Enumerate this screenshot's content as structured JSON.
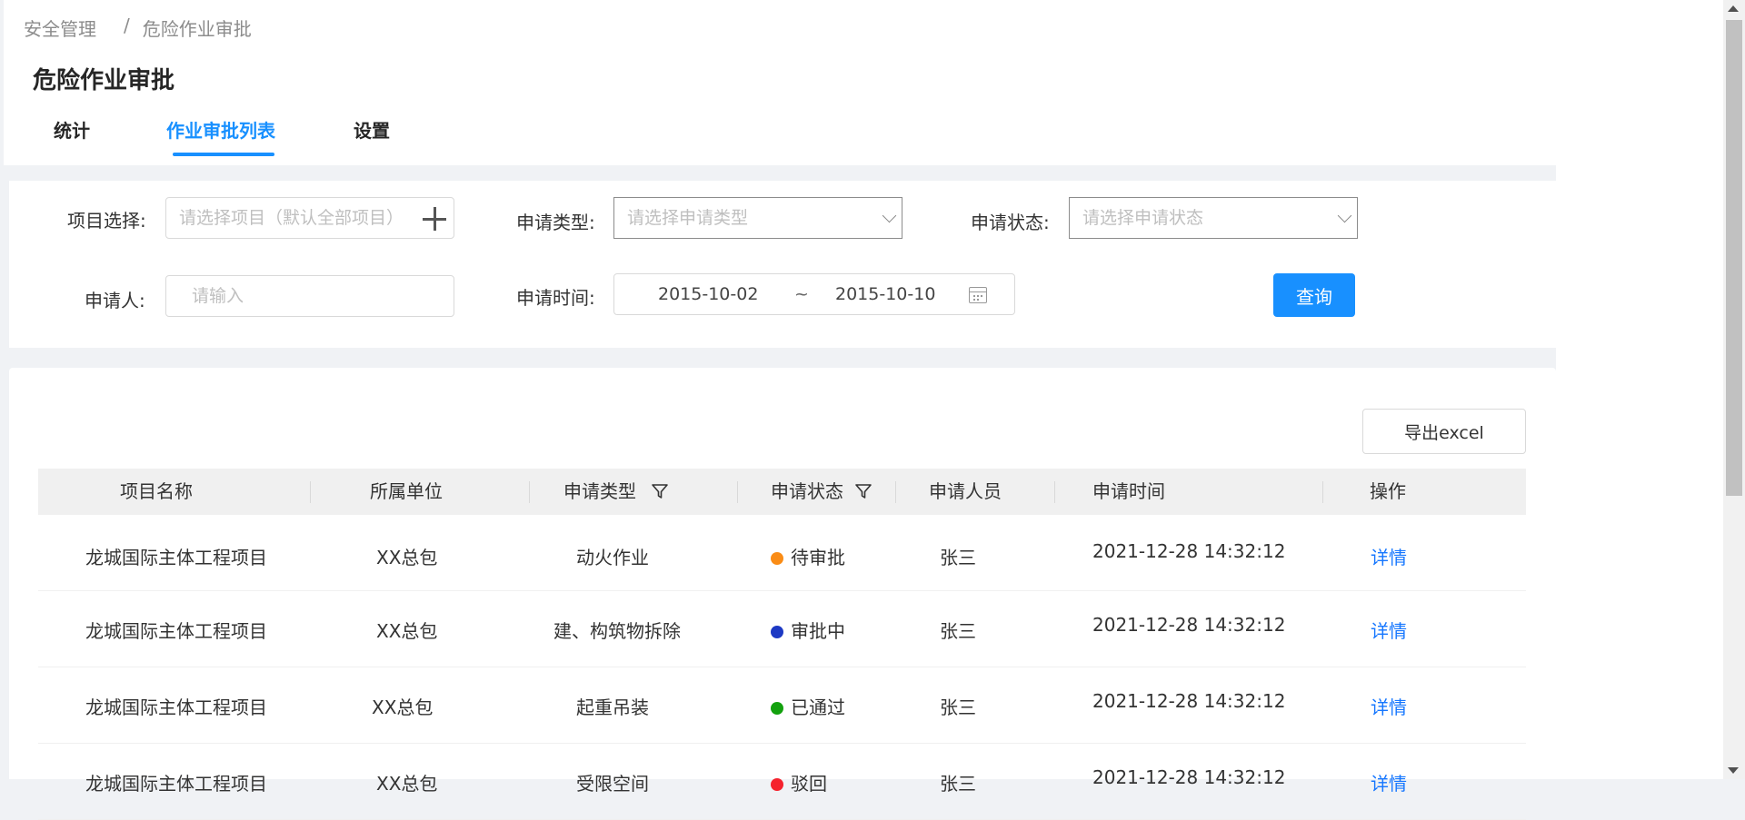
{
  "breadcrumb": {
    "root": "安全管理",
    "separator": "/",
    "current": "危险作业审批"
  },
  "page_title": "危险作业审批",
  "tabs": [
    {
      "label": "统计"
    },
    {
      "label": "作业审批列表",
      "active": true
    },
    {
      "label": "设置"
    }
  ],
  "filters": {
    "project_label": "项目选择:",
    "project_placeholder": "请选择项目（默认全部项目）",
    "type_label": "申请类型:",
    "type_placeholder": "请选择申请类型",
    "status_label": "申请状态:",
    "status_placeholder": "请选择申请状态",
    "applicant_label": "申请人:",
    "applicant_placeholder": "请输入",
    "time_label": "申请时间:",
    "date_start": "2015-10-02",
    "date_sep": "~",
    "date_end": "2015-10-10",
    "query_label": "查询"
  },
  "table": {
    "export_label": "导出excel",
    "columns": [
      "项目名称",
      "所属单位",
      "申请类型",
      "申请状态",
      "申请人员",
      "申请时间",
      "操作"
    ],
    "rows": [
      {
        "project": "龙城国际主体工程项目",
        "unit": "XX总包",
        "type": "动火作业",
        "status": "待审批",
        "status_color": "#fa8c16",
        "applicant": "张三",
        "time": "2021-12-28 14:32:12",
        "action": "详情"
      },
      {
        "project": "龙城国际主体工程项目",
        "unit": "XX总包",
        "type": "建、构筑物拆除",
        "status": "审批中",
        "status_color": "#1d39c4",
        "applicant": "张三",
        "time": "2021-12-28 14:32:12",
        "action": "详情"
      },
      {
        "project": "龙城国际主体工程项目",
        "unit": "XX总包",
        "type": "起重吊装",
        "status": "已通过",
        "status_color": "#13a10e",
        "applicant": "张三",
        "time": "2021-12-28 14:32:12",
        "action": "详情"
      },
      {
        "project": "龙城国际主体工程项目",
        "unit": "XX总包",
        "type": "受限空间",
        "status": "驳回",
        "status_color": "#f5222d",
        "applicant": "张三",
        "time": "2021-12-28 14:32:12",
        "action": "详情"
      }
    ]
  },
  "colors": {
    "primary": "#1890ff",
    "link": "#1677ff",
    "background": "#f0f2f5"
  }
}
